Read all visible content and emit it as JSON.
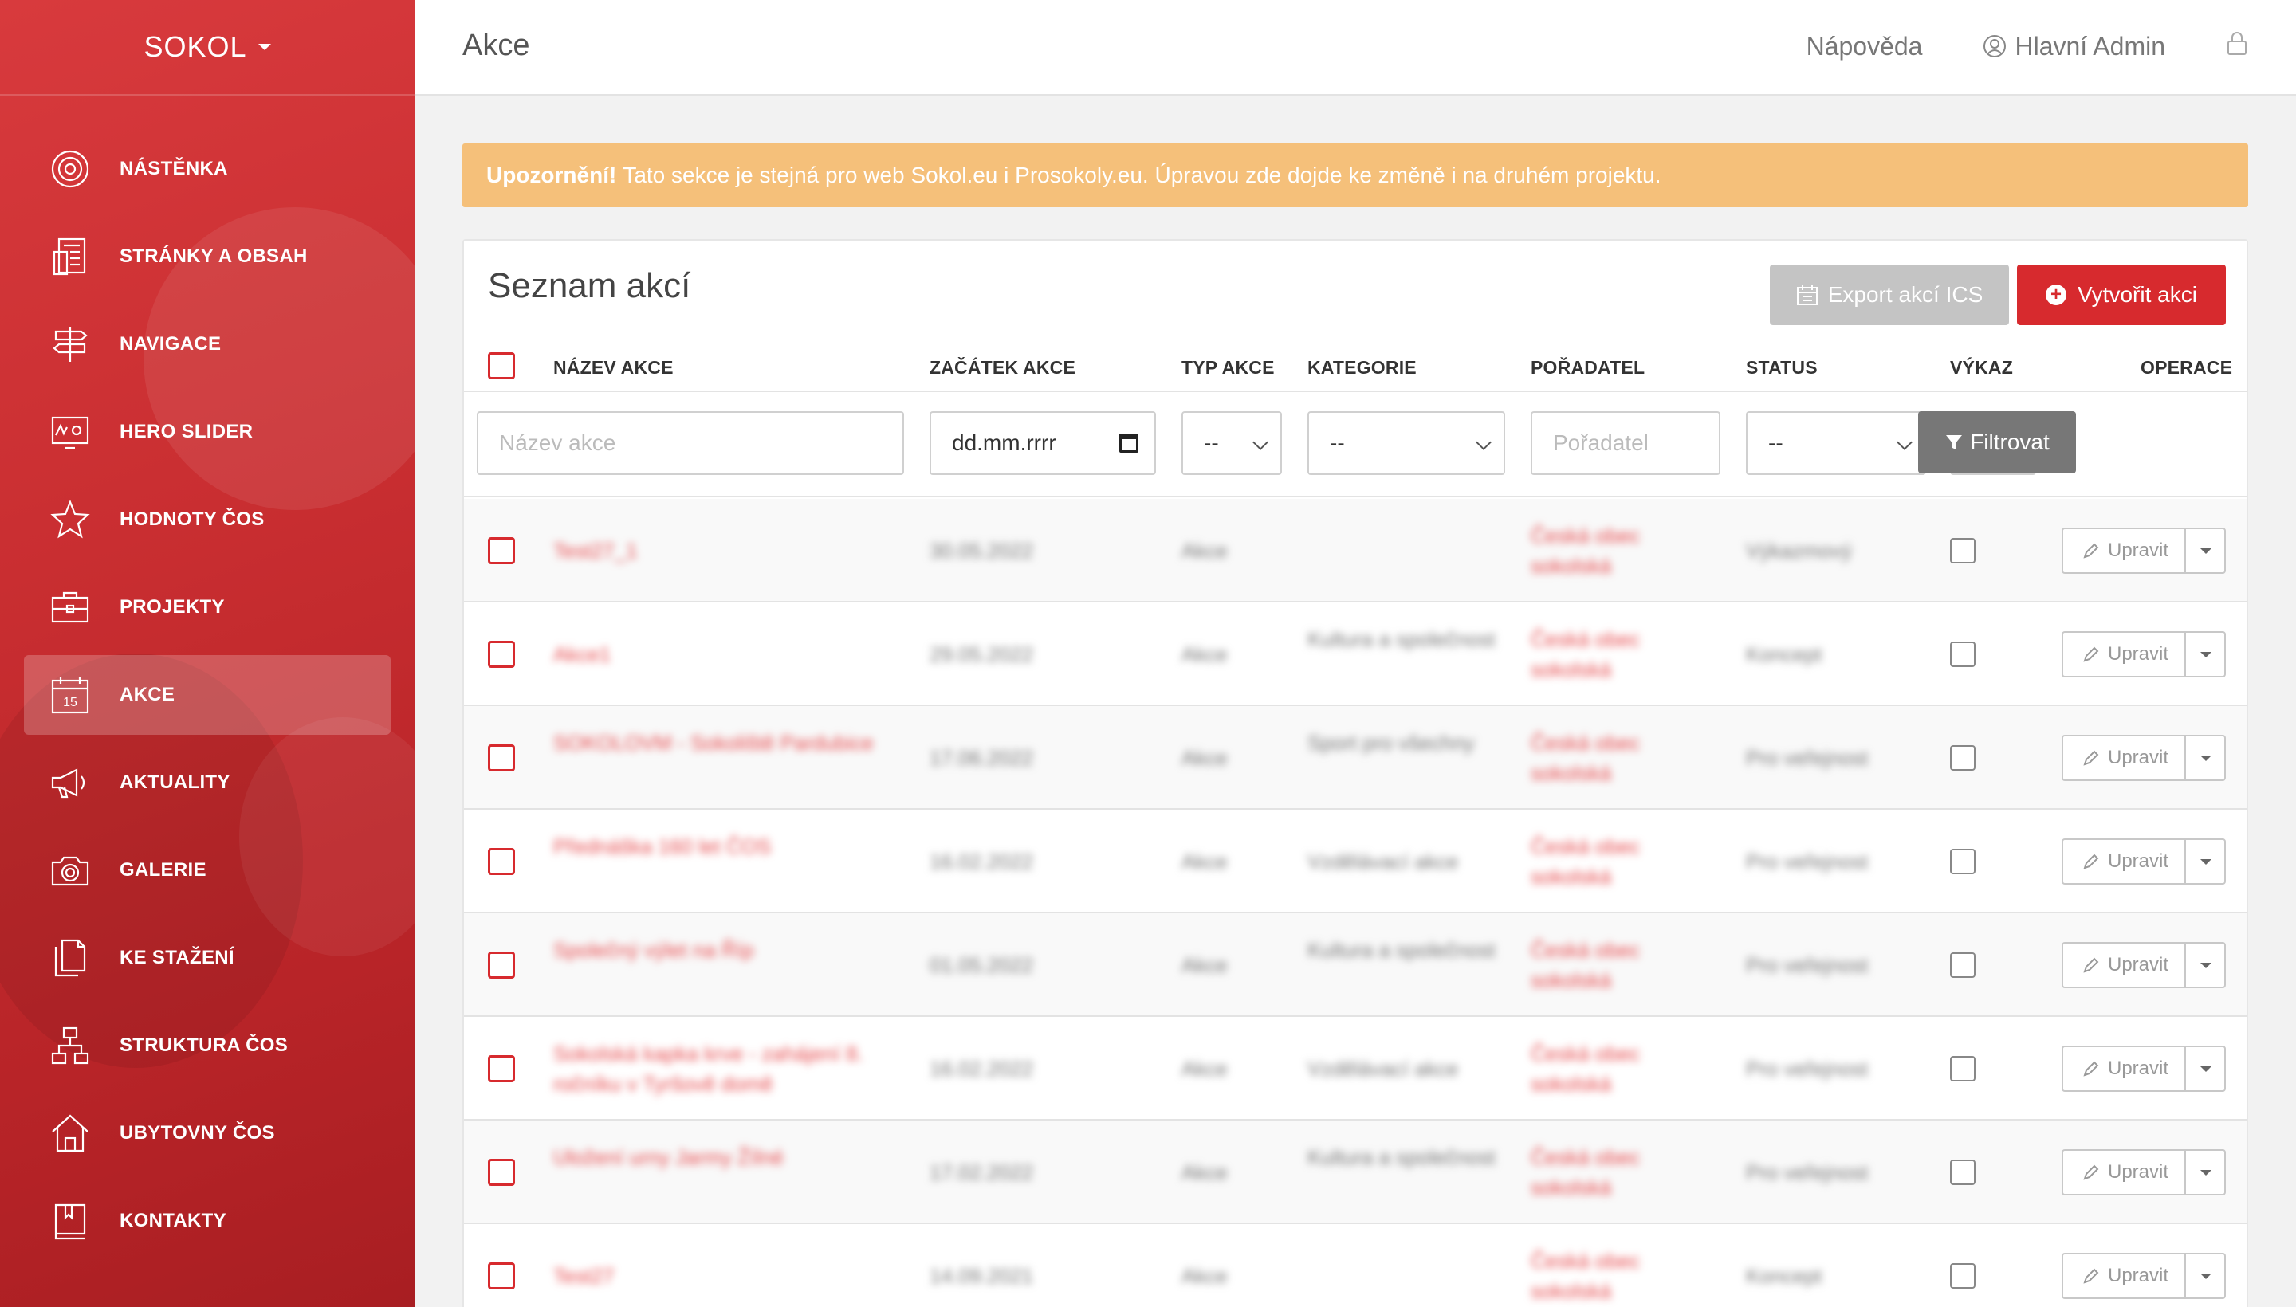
{
  "brand": {
    "name": "SOKOL"
  },
  "sidebar": {
    "items": [
      {
        "label": "NÁSTĚNKA",
        "icon": "target-icon",
        "active": false
      },
      {
        "label": "STRÁNKY A OBSAH",
        "icon": "pages-icon",
        "active": false
      },
      {
        "label": "NAVIGACE",
        "icon": "signpost-icon",
        "active": false
      },
      {
        "label": "HERO SLIDER",
        "icon": "slider-icon",
        "active": false
      },
      {
        "label": "HODNOTY ČOS",
        "icon": "star-icon",
        "active": false
      },
      {
        "label": "PROJEKTY",
        "icon": "briefcase-icon",
        "active": false
      },
      {
        "label": "AKCE",
        "icon": "calendar-icon",
        "active": true
      },
      {
        "label": "AKTUALITY",
        "icon": "megaphone-icon",
        "active": false
      },
      {
        "label": "GALERIE",
        "icon": "camera-icon",
        "active": false
      },
      {
        "label": "KE STAŽENÍ",
        "icon": "document-icon",
        "active": false
      },
      {
        "label": "STRUKTURA ČOS",
        "icon": "hierarchy-icon",
        "active": false
      },
      {
        "label": "UBYTOVNY ČOS",
        "icon": "house-icon",
        "active": false
      },
      {
        "label": "KONTAKTY",
        "icon": "book-icon",
        "active": false
      }
    ],
    "calendar_day": "15"
  },
  "topbar": {
    "title": "Akce",
    "help": "Nápověda",
    "user": "Hlavní Admin"
  },
  "alert": {
    "strong": "Upozornění!",
    "text": "Tato sekce je stejná pro web Sokol.eu i Prosokoly.eu. Úpravou zde dojde ke změně i na druhém projektu."
  },
  "panel": {
    "title": "Seznam akcí",
    "export_label": "Export akcí ICS",
    "create_label": "Vytvořit akci"
  },
  "columns": {
    "name": "NÁZEV AKCE",
    "start": "ZAČÁTEK AKCE",
    "type": "TYP AKCE",
    "category": "KATEGORIE",
    "organizer": "POŘADATEL",
    "status": "STATUS",
    "report": "VÝKAZ",
    "ops": "OPERACE"
  },
  "filters": {
    "name_placeholder": "Název akce",
    "date_value": "dd.mm.rrrr",
    "type_value": "--",
    "category_value": "--",
    "organizer_placeholder": "Pořadatel",
    "status_value": "--",
    "report_value": "--",
    "filter_label": "Filtrovat"
  },
  "rows": [
    {
      "name": "Test27_1",
      "start": "30.05.2022",
      "type": "Akce",
      "category": "",
      "organizer": "Česká obec sokolská",
      "status": "Výkazmový"
    },
    {
      "name": "Akce1",
      "start": "29.05.2022",
      "type": "Akce",
      "category": "Kultura a společnost",
      "organizer": "Česká obec sokolská",
      "status": "Koncept"
    },
    {
      "name": "SOKOLOVM - Sokoliště Pardubice",
      "start": "17.06.2022",
      "type": "Akce",
      "category": "Sport pro všechny",
      "organizer": "Česká obec sokolská",
      "status": "Pro veřejnost"
    },
    {
      "name": "Přednáška 160 let ČOS",
      "start": "16.02.2022",
      "type": "Akce",
      "category": "Vzdělávací akce",
      "organizer": "Česká obec sokolská",
      "status": "Pro veřejnost"
    },
    {
      "name": "Společný výlet na Říp",
      "start": "01.05.2022",
      "type": "Akce",
      "category": "Kultura a společnost",
      "organizer": "Česká obec sokolská",
      "status": "Pro veřejnost"
    },
    {
      "name": "Sokolská kapka krve - zahájení 8. ročníku v Tyršově domě",
      "start": "16.02.2022",
      "type": "Akce",
      "category": "Vzdělávací akce",
      "organizer": "Česká obec sokolská",
      "status": "Pro veřejnost"
    },
    {
      "name": "Uložení urny Jarmy Žílné",
      "start": "17.02.2022",
      "type": "Akce",
      "category": "Kultura a společnost",
      "organizer": "Česká obec sokolská",
      "status": "Pro veřejnost"
    },
    {
      "name": "Test27",
      "start": "14.09.2021",
      "type": "Akce",
      "category": "",
      "organizer": "Česká obec sokolská",
      "status": "Koncept"
    }
  ],
  "row_edit_label": "Upravit",
  "colors": {
    "sidebar_red": "#c92e31",
    "accent_red": "#d72a2e",
    "alert_orange": "#f5c07a",
    "filter_gray": "#777777"
  }
}
